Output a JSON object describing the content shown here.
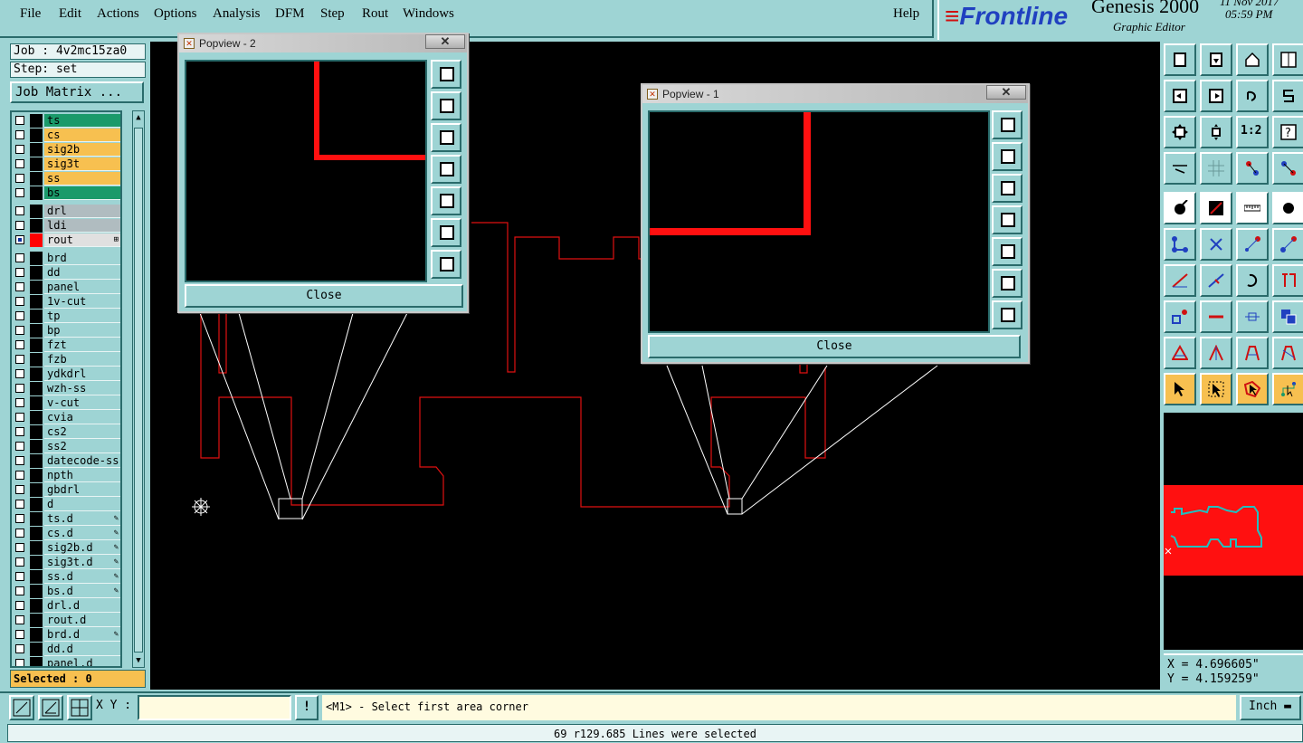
{
  "menu": {
    "items": [
      "File",
      "Edit",
      "Actions",
      "Options",
      "Analysis",
      "DFM",
      "Step",
      "Rout",
      "Windows"
    ],
    "help": "Help"
  },
  "brand": {
    "logo": "Frontline",
    "product": "Genesis 2000",
    "subtitle": "Graphic Editor",
    "date": "11 Nov 2017",
    "time": "05:59 PM"
  },
  "job": {
    "job_label": "Job : 4v2mc15za0",
    "step_label": "Step: set",
    "matrix_button": "Job Matrix ..."
  },
  "layers": [
    {
      "name": "ts",
      "color": "#1a9a6a"
    },
    {
      "name": "cs",
      "color": "#f7c050"
    },
    {
      "name": "sig2b",
      "color": "#f7c050"
    },
    {
      "name": "sig3t",
      "color": "#f7c050"
    },
    {
      "name": "ss",
      "color": "#f7c050"
    },
    {
      "name": "bs",
      "color": "#1a9a6a"
    },
    {
      "name": "drl",
      "color": "#b0bcc0"
    },
    {
      "name": "ldi",
      "color": "#b0bcc0"
    },
    {
      "name": "rout",
      "color": "#e0e0e0",
      "active": true,
      "swatch": "#ff0000"
    },
    {
      "name": "brd",
      "color": "#9ed4d4"
    },
    {
      "name": "dd",
      "color": "#9ed4d4"
    },
    {
      "name": "panel",
      "color": "#9ed4d4"
    },
    {
      "name": "1v-cut",
      "color": "#9ed4d4"
    },
    {
      "name": "tp",
      "color": "#9ed4d4"
    },
    {
      "name": "bp",
      "color": "#9ed4d4"
    },
    {
      "name": "fzt",
      "color": "#9ed4d4"
    },
    {
      "name": "fzb",
      "color": "#9ed4d4"
    },
    {
      "name": "ydkdrl",
      "color": "#9ed4d4"
    },
    {
      "name": "wzh-ss",
      "color": "#9ed4d4"
    },
    {
      "name": "v-cut",
      "color": "#9ed4d4"
    },
    {
      "name": "cvia",
      "color": "#9ed4d4"
    },
    {
      "name": "cs2",
      "color": "#9ed4d4"
    },
    {
      "name": "ss2",
      "color": "#9ed4d4"
    },
    {
      "name": "datecode-ss",
      "color": "#9ed4d4"
    },
    {
      "name": "npth",
      "color": "#9ed4d4"
    },
    {
      "name": "gbdrl",
      "color": "#9ed4d4"
    },
    {
      "name": "d",
      "color": "#9ed4d4"
    },
    {
      "name": "ts.d",
      "color": "#9ed4d4",
      "mark": true
    },
    {
      "name": "cs.d",
      "color": "#9ed4d4",
      "mark": true
    },
    {
      "name": "sig2b.d",
      "color": "#9ed4d4",
      "mark": true
    },
    {
      "name": "sig3t.d",
      "color": "#9ed4d4",
      "mark": true
    },
    {
      "name": "ss.d",
      "color": "#9ed4d4",
      "mark": true
    },
    {
      "name": "bs.d",
      "color": "#9ed4d4",
      "mark": true
    },
    {
      "name": "drl.d",
      "color": "#9ed4d4"
    },
    {
      "name": "rout.d",
      "color": "#9ed4d4"
    },
    {
      "name": "brd.d",
      "color": "#9ed4d4",
      "mark": true
    },
    {
      "name": "dd.d",
      "color": "#9ed4d4"
    },
    {
      "name": "panel.d",
      "color": "#9ed4d4"
    }
  ],
  "selected_label": "Selected : 0",
  "popup2": {
    "title": "Popview - 2",
    "close": "Close"
  },
  "popup1": {
    "title": "Popview - 1",
    "close": "Close"
  },
  "coords": {
    "x": "X = 4.696605\"",
    "y": "Y = 4.159259\""
  },
  "bottom": {
    "xy_label": "X Y :",
    "xy_value": "",
    "bang": "!",
    "prompt": "<M1> - Select first area corner",
    "unit": "Inch"
  },
  "status": "69 r129.685 Lines were selected",
  "colors": {
    "accent": "#9ed4d4",
    "rout": "#ff0000",
    "highlight": "#f7c050"
  }
}
